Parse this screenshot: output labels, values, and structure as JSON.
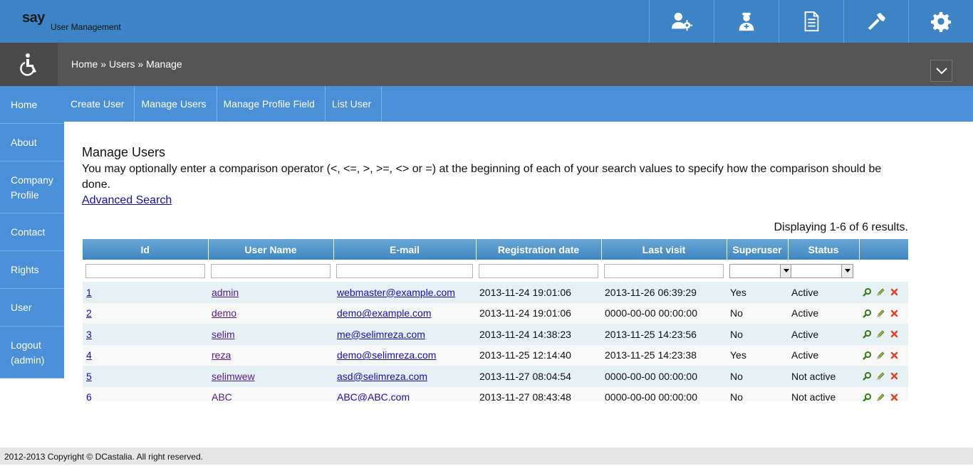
{
  "brand": {
    "logo": "say",
    "subtitle": "User Management"
  },
  "top_icons": [
    "users-gear-icon",
    "doctor-icon",
    "document-icon",
    "tools-icon",
    "gear-icon"
  ],
  "breadcrumb": {
    "home": "Home",
    "sep1": "»",
    "users": "Users",
    "sep2": "»",
    "current": "Manage"
  },
  "sidebar": {
    "items": [
      {
        "label": "Home"
      },
      {
        "label": "About"
      },
      {
        "label": "Company Profile"
      },
      {
        "label": "Contact"
      },
      {
        "label": "Rights"
      },
      {
        "label": "User"
      },
      {
        "label": "Logout (admin)"
      }
    ]
  },
  "submenu": {
    "items": [
      {
        "label": "Create User"
      },
      {
        "label": "Manage Users"
      },
      {
        "label": "Manage Profile Field"
      },
      {
        "label": "List User"
      }
    ]
  },
  "main": {
    "title": "Manage Users",
    "description": "You may optionally enter a comparison operator (<, <=, >, >=, <> or =) at the beginning of each of your search values to specify how the comparison should be done.",
    "advanced_search": "Advanced Search",
    "summary": "Displaying 1-6 of 6 results."
  },
  "grid": {
    "columns": [
      "Id",
      "User Name",
      "E-mail",
      "Registration date",
      "Last visit",
      "Superuser",
      "Status",
      ""
    ],
    "rows": [
      {
        "id": "1",
        "username": "admin",
        "email": "webmaster@example.com",
        "registered": "2013-11-24 19:01:06",
        "last_visit": "2013-11-26 06:39:29",
        "superuser": "Yes",
        "status": "Active"
      },
      {
        "id": "2",
        "username": "demo",
        "email": "demo@example.com",
        "registered": "2013-11-24 19:01:06",
        "last_visit": "0000-00-00 00:00:00",
        "superuser": "No",
        "status": "Active"
      },
      {
        "id": "3",
        "username": "selim",
        "email": "me@selimreza.com",
        "registered": "2013-11-24 14:38:23",
        "last_visit": "2013-11-25 14:23:56",
        "superuser": "No",
        "status": "Active"
      },
      {
        "id": "4",
        "username": "reza",
        "email": "demo@selimreza.com",
        "registered": "2013-11-25 12:14:40",
        "last_visit": "2013-11-25 14:23:38",
        "superuser": "Yes",
        "status": "Active"
      },
      {
        "id": "5",
        "username": "selimwew",
        "email": "asd@selimreza.com",
        "registered": "2013-11-27 08:04:54",
        "last_visit": "0000-00-00 00:00:00",
        "superuser": "No",
        "status": "Not active"
      },
      {
        "id": "6",
        "username": "ABC",
        "email": "ABC@ABC.com",
        "registered": "2013-11-27 08:43:48",
        "last_visit": "0000-00-00 00:00:00",
        "superuser": "No",
        "status": "Not active"
      }
    ]
  },
  "footer": {
    "text": "2012-2013 Copyright © DCastalia. All right reserved."
  },
  "colors": {
    "header": "#3d84c6",
    "menu": "#4a90d9",
    "crumbbar": "#555555",
    "row_odd": "#e5f1f4"
  }
}
